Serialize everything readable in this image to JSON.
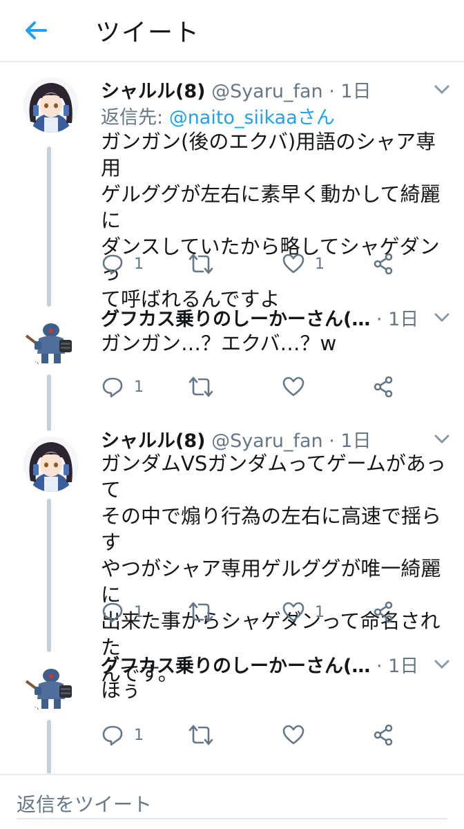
{
  "header": {
    "title": "ツイート"
  },
  "tweets": [
    {
      "name": "シャルル(8)",
      "handle": "@Syaru_fan",
      "sep": "·",
      "time": "1日",
      "reply_to_prefix": "返信先: ",
      "reply_to_mention": "@naito_siikaa",
      "reply_to_suffix": "さん",
      "text": "ガンガン(後のエクバ)用語のシャア専用\nゲルググが左右に素早く動かして綺麗に\nダンスしていたから略してシャゲダンっ\nて呼ばれるんですよ",
      "reply_count": "1",
      "retweet_count": "",
      "like_count": "1"
    },
    {
      "name": "グフカス乗りのしーかーさん(…",
      "handle": "",
      "sep": "·",
      "time": "1日",
      "text": "ガンガン…？エクバ…？w",
      "reply_count": "1",
      "retweet_count": "",
      "like_count": ""
    },
    {
      "name": "シャルル(8)",
      "handle": "@Syaru_fan",
      "sep": "·",
      "time": "1日",
      "text": "ガンダムVSガンダムってゲームがあって\nその中で煽り行為の左右に高速で揺らす\nやつがシャア専用ゲルググが唯一綺麗に\n出来た事からシャゲダンって命名された\nんです。",
      "reply_count": "1",
      "retweet_count": "",
      "like_count": "1"
    },
    {
      "name": "グフカス乗りのしーかーさん(…",
      "handle": "",
      "sep": "·",
      "time": "1日",
      "text": "ほぅ",
      "reply_count": "1",
      "retweet_count": "",
      "like_count": ""
    }
  ],
  "reply_bar": {
    "placeholder": "返信をツイート"
  },
  "colors": {
    "accent": "#1da1f2",
    "secondary_text": "#657786",
    "thread_line": "#c4d0da"
  },
  "icons": [
    "back-arrow-icon",
    "chevron-down-icon",
    "reply-icon",
    "retweet-icon",
    "like-icon",
    "share-icon"
  ]
}
